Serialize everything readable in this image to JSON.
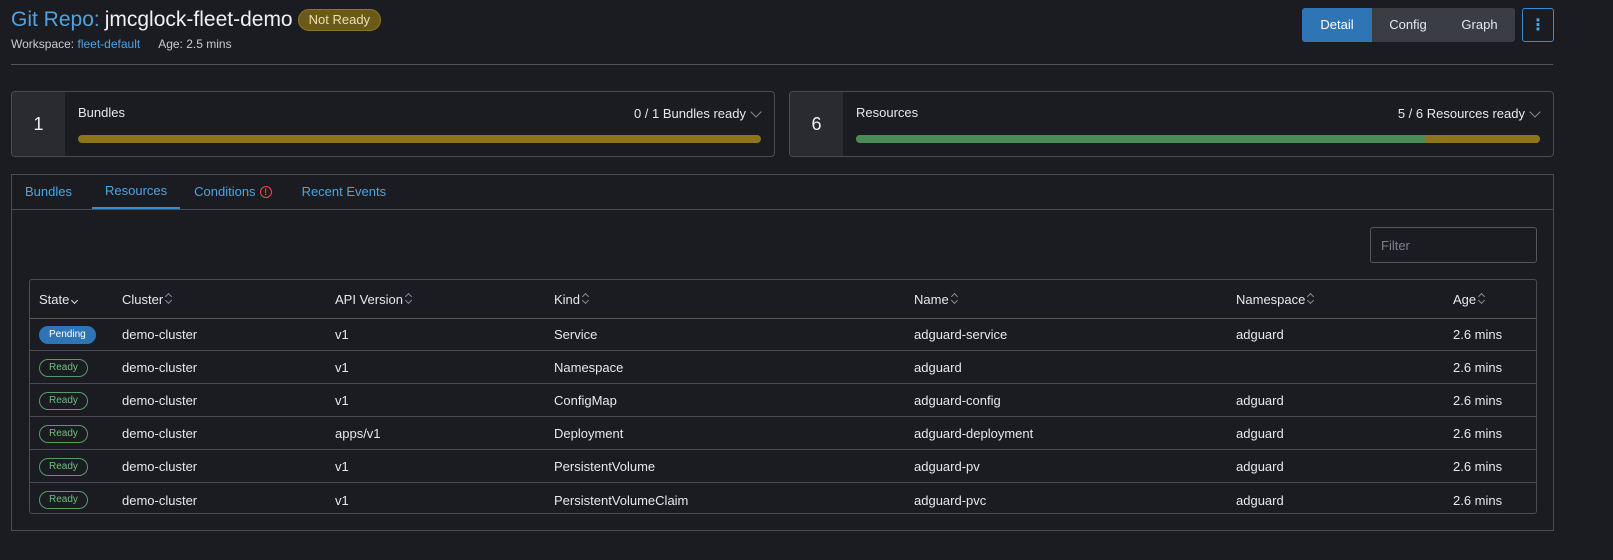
{
  "header": {
    "title_prefix": "Git Repo:",
    "title_name": "jmcglock-fleet-demo",
    "status": "Not Ready",
    "workspace_label": "Workspace:",
    "workspace_value": "fleet-default",
    "age": "Age: 2.5 mins",
    "view_buttons": [
      "Detail",
      "Config",
      "Graph"
    ],
    "menu_icon": "kebab-menu-icon"
  },
  "cards": {
    "bundles": {
      "count": "1",
      "label": "Bundles",
      "ready_text": "0 / 1 Bundles ready",
      "ready_fraction": 0.0
    },
    "resources": {
      "count": "6",
      "label": "Resources",
      "ready_text": "5 / 6 Resources ready",
      "ready_fraction": 0.8333
    }
  },
  "tabs": [
    {
      "label": "Bundles"
    },
    {
      "label": "Resources"
    },
    {
      "label": "Conditions"
    },
    {
      "label": "Recent Events"
    }
  ],
  "filter": {
    "placeholder": "Filter"
  },
  "table": {
    "columns": [
      "State",
      "Cluster",
      "API Version",
      "Kind",
      "Name",
      "Namespace",
      "Age"
    ],
    "rows": [
      {
        "state": "Pending",
        "cluster": "demo-cluster",
        "api": "v1",
        "kind": "Service",
        "name": "adguard-service",
        "namespace": "adguard",
        "age": "2.6 mins"
      },
      {
        "state": "Ready",
        "cluster": "demo-cluster",
        "api": "v1",
        "kind": "Namespace",
        "name": "adguard",
        "namespace": "",
        "age": "2.6 mins"
      },
      {
        "state": "Ready",
        "cluster": "demo-cluster",
        "api": "v1",
        "kind": "ConfigMap",
        "name": "adguard-config",
        "namespace": "adguard",
        "age": "2.6 mins"
      },
      {
        "state": "Ready",
        "cluster": "demo-cluster",
        "api": "apps/v1",
        "kind": "Deployment",
        "name": "adguard-deployment",
        "namespace": "adguard",
        "age": "2.6 mins"
      },
      {
        "state": "Ready",
        "cluster": "demo-cluster",
        "api": "v1",
        "kind": "PersistentVolume",
        "name": "adguard-pv",
        "namespace": "adguard",
        "age": "2.6 mins"
      },
      {
        "state": "Ready",
        "cluster": "demo-cluster",
        "api": "v1",
        "kind": "PersistentVolumeClaim",
        "name": "adguard-pvc",
        "namespace": "adguard",
        "age": "2.6 mins"
      }
    ]
  },
  "colors": {
    "accent": "#4fa3e0",
    "not_ready": "#8d7419",
    "ready": "#4a8b57",
    "pending": "#2f74b5"
  }
}
